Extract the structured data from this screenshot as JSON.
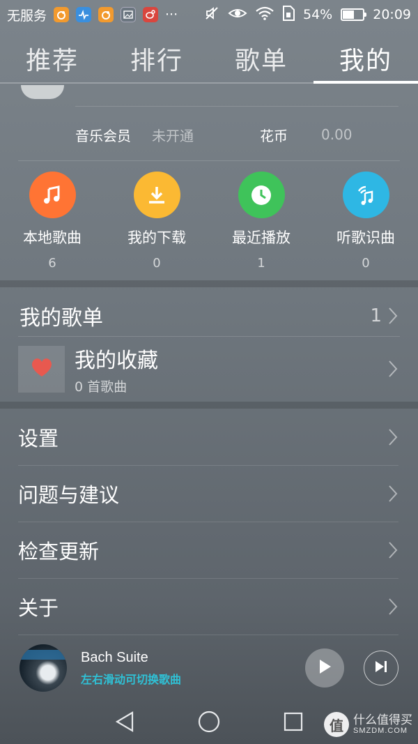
{
  "status_bar": {
    "carrier": "无服务",
    "battery_percent": "54%",
    "battery_level": 0.54,
    "time": "20:09",
    "more_indicator": "···",
    "icons": [
      "uc-browser-icon",
      "health-icon",
      "uc-browser-icon",
      "gallery-icon",
      "weibo-icon",
      "mute-icon",
      "eye-icon",
      "wifi-icon",
      "sim-icon",
      "battery-icon"
    ]
  },
  "tabs": [
    {
      "label": "推荐",
      "active": false
    },
    {
      "label": "排行",
      "active": false
    },
    {
      "label": "歌单",
      "active": false
    },
    {
      "label": "我的",
      "active": true
    }
  ],
  "profile": {
    "member_label": "音乐会员",
    "member_value": "未开通",
    "coins_label": "花币",
    "coins_value": "0.00"
  },
  "quick_actions": [
    {
      "label": "本地歌曲",
      "count": "6",
      "color": "#ff7434",
      "icon": "music-note-icon"
    },
    {
      "label": "我的下载",
      "count": "0",
      "color": "#fbb933",
      "icon": "download-icon"
    },
    {
      "label": "最近播放",
      "count": "1",
      "color": "#3fc35a",
      "icon": "clock-icon"
    },
    {
      "label": "听歌识曲",
      "count": "0",
      "color": "#2eb7e4",
      "icon": "music-recognition-icon"
    }
  ],
  "playlists": {
    "header_label": "我的歌单",
    "count": "1",
    "favorite_title": "我的收藏",
    "favorite_subtitle": "0 首歌曲",
    "heart_color": "#e8594f"
  },
  "menu": [
    {
      "label": "设置"
    },
    {
      "label": "问题与建议"
    },
    {
      "label": "检查更新"
    },
    {
      "label": "关于"
    }
  ],
  "player": {
    "title": "Bach Suite",
    "hint": "左右滑动可切换歌曲",
    "hint_color": "#2fc1d6"
  },
  "watermark": {
    "logo_char": "值",
    "cn": "什么值得买",
    "en": "SMZDM.COM"
  }
}
